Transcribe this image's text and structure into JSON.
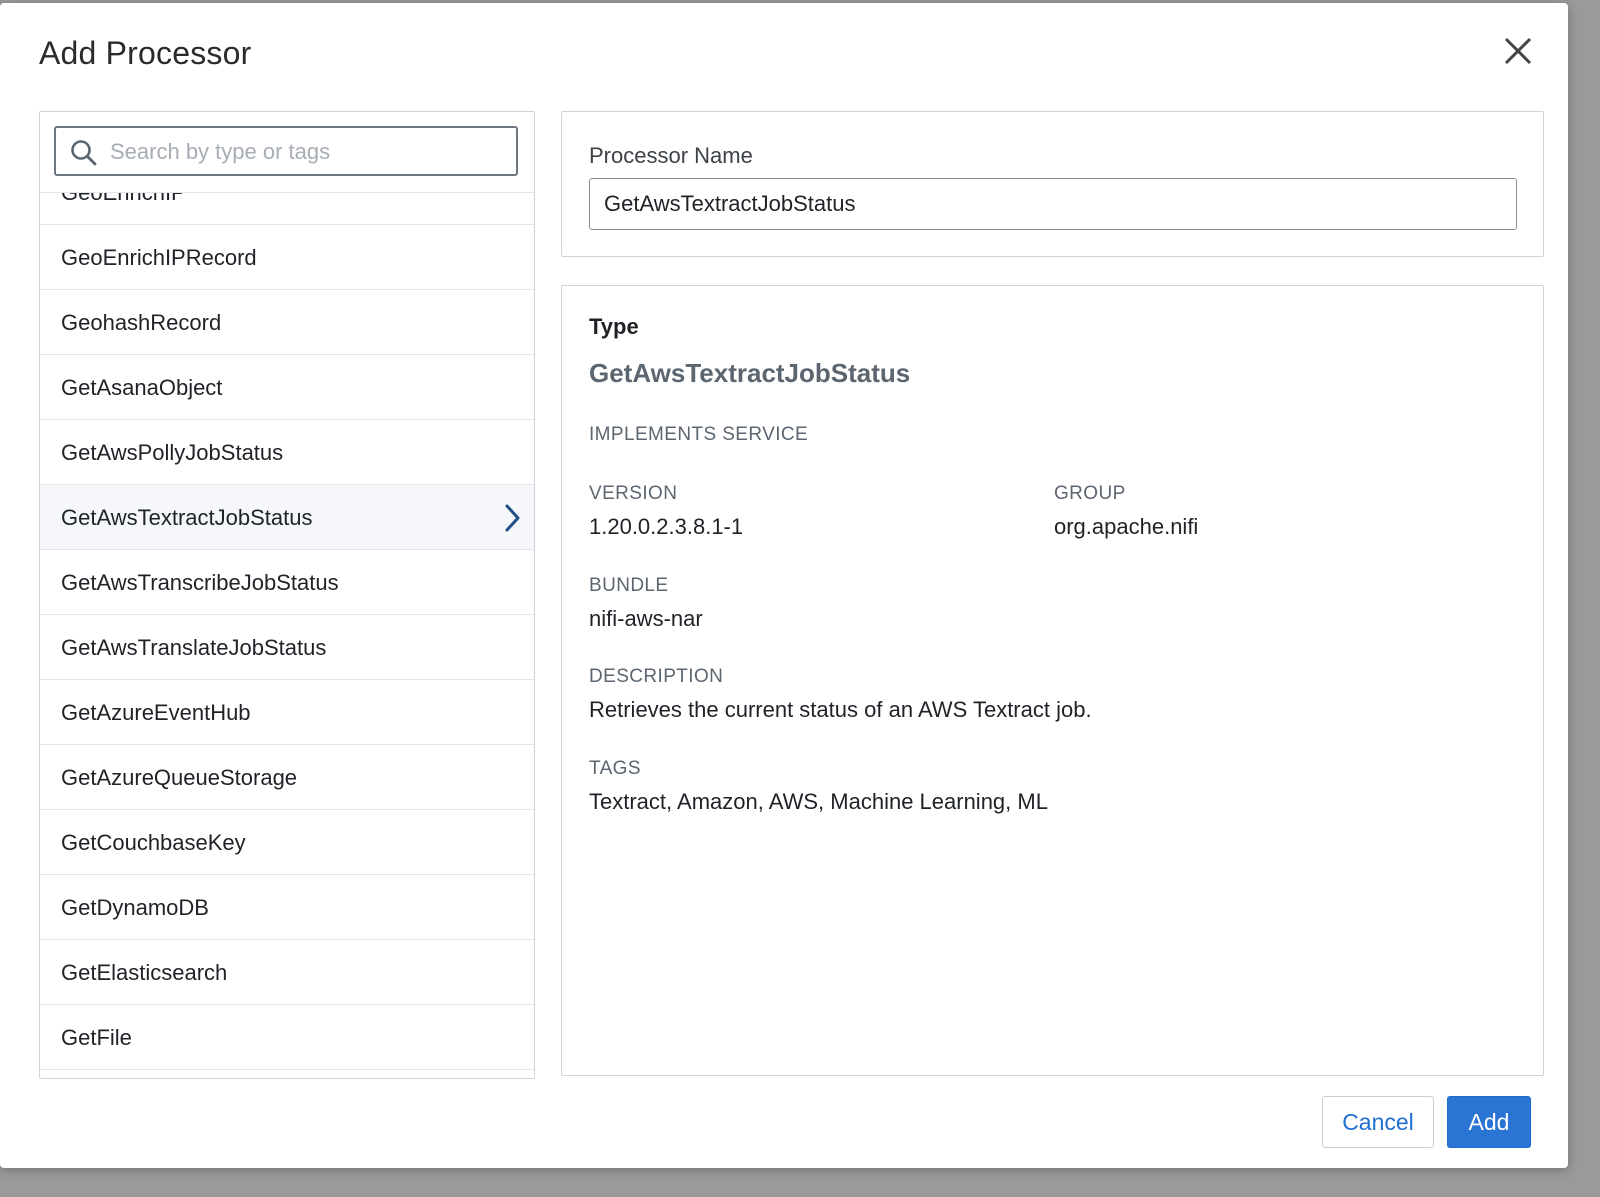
{
  "dialog": {
    "title": "Add Processor",
    "close_icon": "close-icon"
  },
  "search": {
    "placeholder": "Search by type or tags",
    "value": "",
    "icon": "search-icon"
  },
  "list": {
    "items": [
      {
        "label": "GeoEnrichIP"
      },
      {
        "label": "GeoEnrichIPRecord"
      },
      {
        "label": "GeohashRecord"
      },
      {
        "label": "GetAsanaObject"
      },
      {
        "label": "GetAwsPollyJobStatus"
      },
      {
        "label": "GetAwsTextractJobStatus",
        "selected": true,
        "icon": "chevron-right-icon"
      },
      {
        "label": "GetAwsTranscribeJobStatus"
      },
      {
        "label": "GetAwsTranslateJobStatus"
      },
      {
        "label": "GetAzureEventHub"
      },
      {
        "label": "GetAzureQueueStorage"
      },
      {
        "label": "GetCouchbaseKey"
      },
      {
        "label": "GetDynamoDB"
      },
      {
        "label": "GetElasticsearch"
      },
      {
        "label": "GetFile"
      }
    ]
  },
  "name_panel": {
    "label": "Processor Name",
    "value": "GetAwsTextractJobStatus"
  },
  "details": {
    "type_heading": "Type",
    "type_value": "GetAwsTextractJobStatus",
    "implements_service_label": "IMPLEMENTS SERVICE",
    "version_label": "VERSION",
    "version_value": "1.20.0.2.3.8.1-1",
    "group_label": "GROUP",
    "group_value": "org.apache.nifi",
    "bundle_label": "BUNDLE",
    "bundle_value": "nifi-aws-nar",
    "description_label": "DESCRIPTION",
    "description_value": "Retrieves the current status of an AWS Textract job.",
    "tags_label": "TAGS",
    "tags_value": "Textract, Amazon, AWS, Machine Learning, ML"
  },
  "footer": {
    "cancel_label": "Cancel",
    "add_label": "Add"
  },
  "colors": {
    "primary": "#2a75d3",
    "selected_row": "#f5f7fa",
    "border": "#cfd3d8"
  }
}
